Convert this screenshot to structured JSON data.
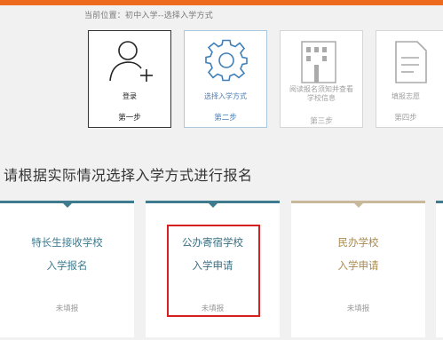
{
  "breadcrumb": "当前位置：初中入学--选择入学方式",
  "steps": [
    {
      "title": "登录",
      "step": "第一步",
      "icon": "user-add-icon"
    },
    {
      "title": "选择入学方式",
      "step": "第二步",
      "icon": "gear-icon"
    },
    {
      "title": "阅读报名须知并查看学校信息",
      "step": "第三步",
      "icon": "building-icon"
    },
    {
      "title": "填报志愿",
      "step": "第四步",
      "icon": "document-icon"
    }
  ],
  "section_title": "请根据实际情况选择入学方式进行报名",
  "cards": [
    {
      "line1": "特长生接收学校",
      "line2": "入学报名",
      "status": "未填报"
    },
    {
      "line1": "公办寄宿学校",
      "line2": "入学申请",
      "status": "未填报"
    },
    {
      "line1": "民办学校",
      "line2": "入学申请",
      "status": "未填报"
    }
  ],
  "colors": {
    "accent": "#ee6a1f",
    "teal": "#3e7b8f",
    "tan": "#a88a4e",
    "highlight": "#d62020"
  }
}
